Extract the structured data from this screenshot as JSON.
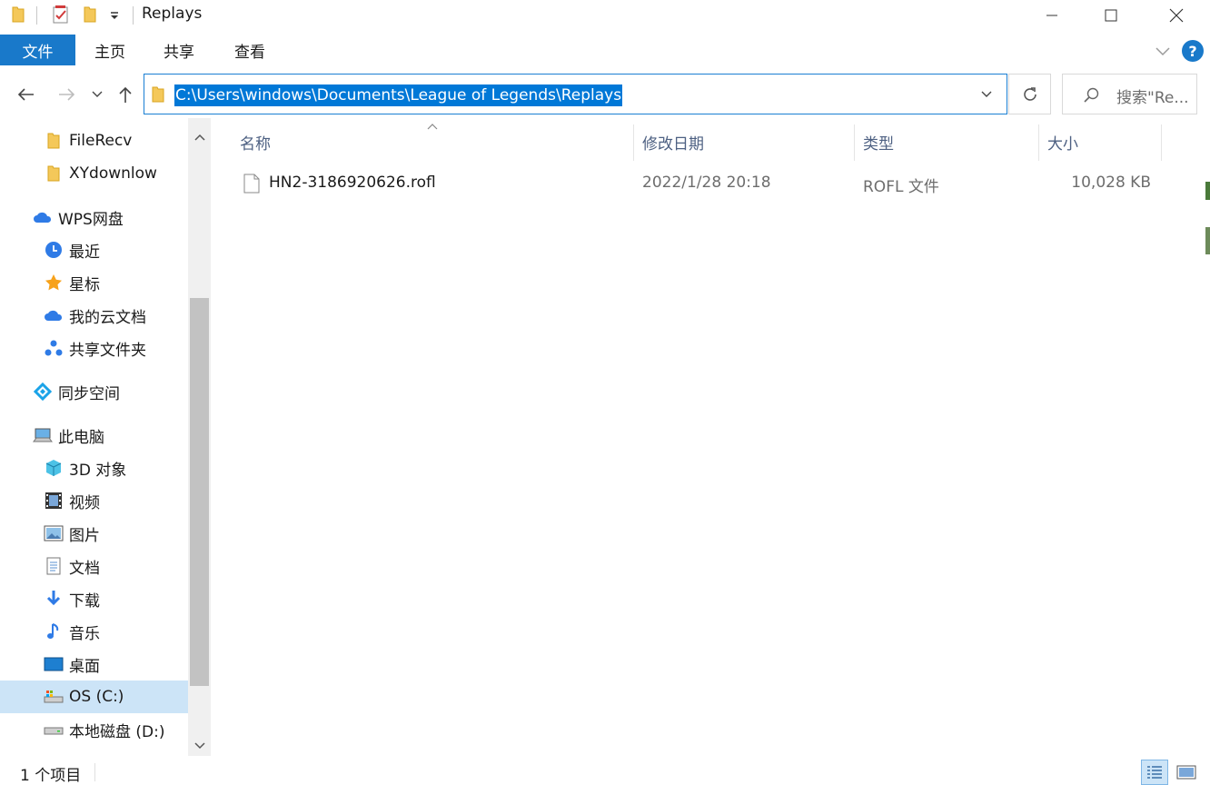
{
  "window": {
    "title": "Replays"
  },
  "ribbon": {
    "tabs": [
      "文件",
      "主页",
      "共享",
      "查看"
    ]
  },
  "address_bar": {
    "path": "C:\\Users\\windows\\Documents\\League of Legends\\Replays"
  },
  "search": {
    "placeholder": "搜索\"Re..."
  },
  "sidebar": {
    "items": [
      {
        "label": "FileRecv",
        "icon": "folder-icon"
      },
      {
        "label": "XYdownlow",
        "icon": "folder-icon"
      },
      {
        "label": "WPS网盘",
        "icon": "cloud-icon"
      },
      {
        "label": "最近",
        "icon": "clock-icon"
      },
      {
        "label": "星标",
        "icon": "star-icon"
      },
      {
        "label": "我的云文档",
        "icon": "cloud-icon"
      },
      {
        "label": "共享文件夹",
        "icon": "share-nodes-icon"
      },
      {
        "label": "同步空间",
        "icon": "sync-diamond-icon"
      },
      {
        "label": "此电脑",
        "icon": "computer-icon"
      },
      {
        "label": "3D 对象",
        "icon": "cube-icon"
      },
      {
        "label": "视频",
        "icon": "film-icon"
      },
      {
        "label": "图片",
        "icon": "picture-icon"
      },
      {
        "label": "文档",
        "icon": "document-icon"
      },
      {
        "label": "下载",
        "icon": "download-arrow-icon"
      },
      {
        "label": "音乐",
        "icon": "music-note-icon"
      },
      {
        "label": "桌面",
        "icon": "desktop-icon"
      },
      {
        "label": "OS (C:)",
        "icon": "drive-icon"
      },
      {
        "label": "本地磁盘 (D:)",
        "icon": "drive-icon"
      }
    ]
  },
  "file_list": {
    "columns": [
      "名称",
      "修改日期",
      "类型",
      "大小"
    ],
    "rows": [
      {
        "name": "HN2-3186920626.rofl",
        "modified": "2022/1/28 20:18",
        "type": "ROFL 文件",
        "size": "10,028 KB"
      }
    ]
  },
  "status_bar": {
    "item_count": "1 个项目"
  },
  "colors": {
    "accent": "#0078d7",
    "file_tab": "#1979ca",
    "selected_nav": "#cce4f7"
  }
}
